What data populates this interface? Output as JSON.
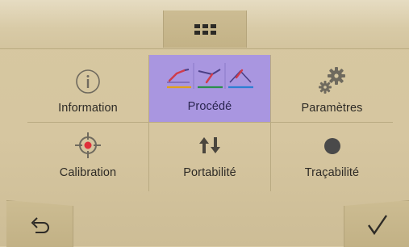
{
  "header": {
    "menu_icon": "grid-menu-icon"
  },
  "tiles": [
    {
      "label": "Information",
      "icon": "info-icon",
      "selected": false
    },
    {
      "label": "Procédé",
      "icon": "process-icons",
      "selected": true
    },
    {
      "label": "Paramètres",
      "icon": "gears-icon",
      "selected": false
    },
    {
      "label": "Calibration",
      "icon": "crosshair-icon",
      "selected": false
    },
    {
      "label": "Portabilité",
      "icon": "up-down-arrows-icon",
      "selected": false
    },
    {
      "label": "Traçabilité",
      "icon": "dot-icon",
      "selected": false
    }
  ],
  "footer": {
    "back_icon": "back-arrow-icon",
    "confirm_icon": "checkmark-icon"
  },
  "colors": {
    "background": "#d7c8a1",
    "selected": "#a996e0",
    "process_icon_1_underline": "#e0a21a",
    "process_icon_2_underline": "#2b8f4b",
    "process_icon_3_underline": "#2d7fd3",
    "icon_red": "#e0303a"
  }
}
